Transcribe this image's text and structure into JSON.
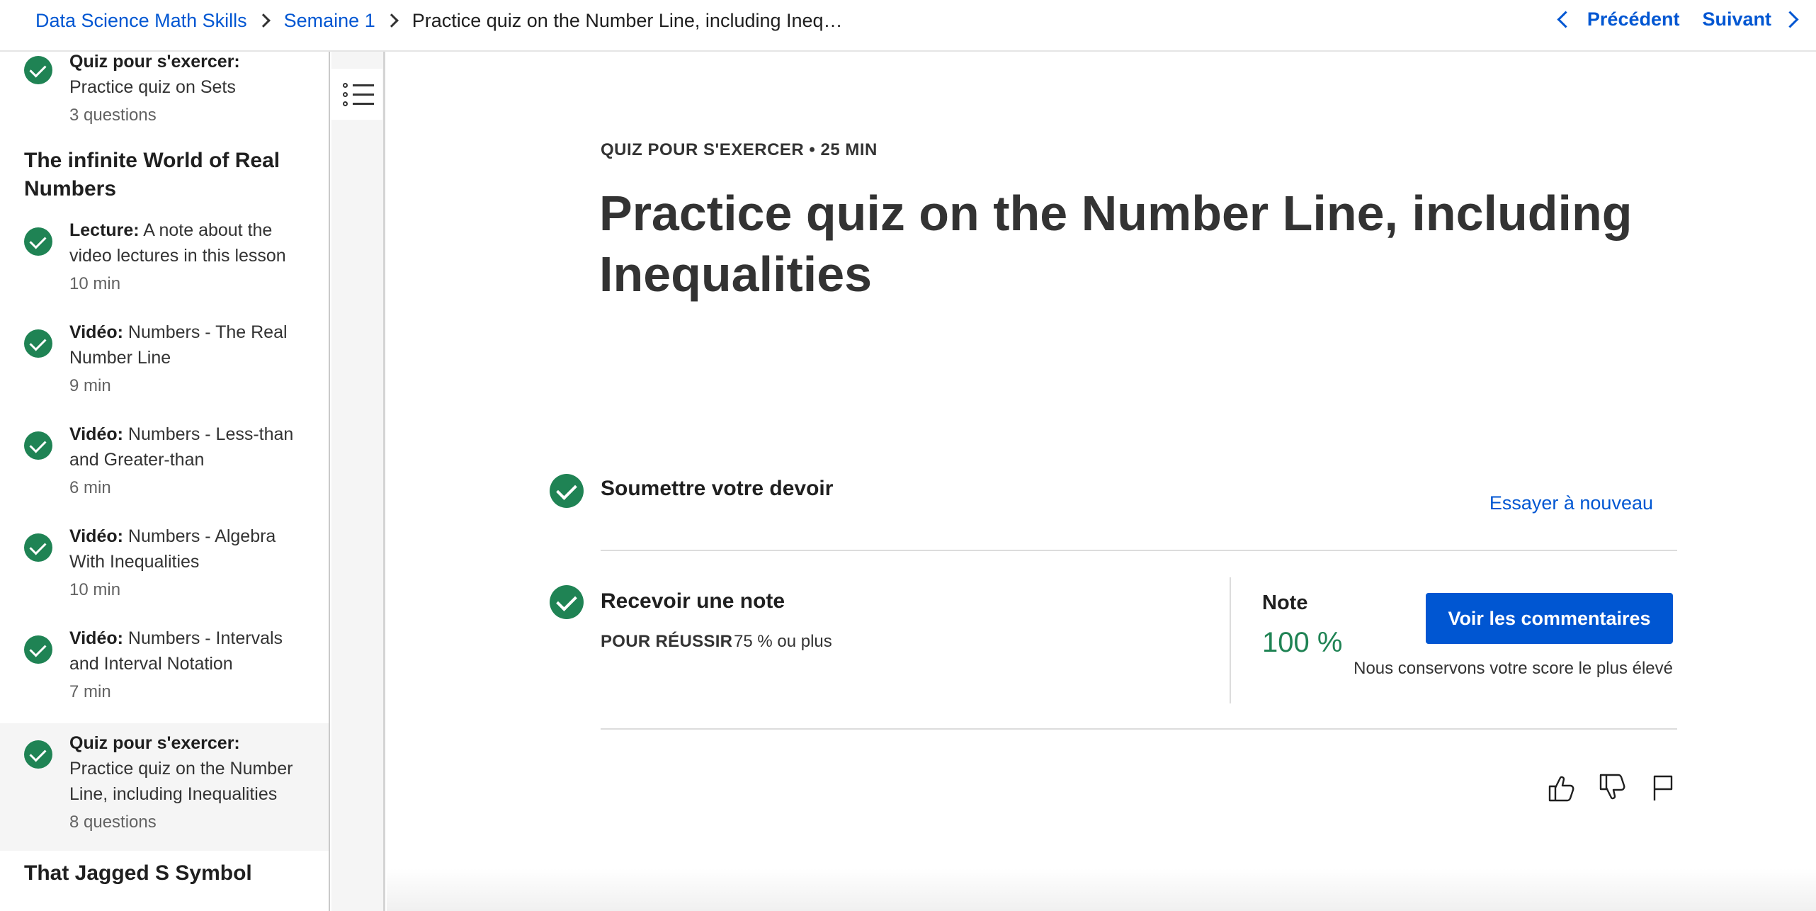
{
  "breadcrumb": {
    "course": "Data Science Math Skills",
    "week": "Semaine 1",
    "current": "Practice quiz on the Number Line, including Ineq…"
  },
  "nav": {
    "prev": "Précédent",
    "next": "Suivant"
  },
  "sidebar": {
    "top_item": {
      "type": "Quiz pour s'exercer:",
      "title": "Practice quiz on Sets",
      "meta": "3 questions"
    },
    "section1_title": "The infinite World of Real Numbers",
    "items": [
      {
        "type": "Lecture:",
        "title": "A note about the video lectures in this lesson",
        "meta": "10 min"
      },
      {
        "type": "Vidéo:",
        "title": "Numbers - The Real Number Line",
        "meta": "9 min"
      },
      {
        "type": "Vidéo:",
        "title": "Numbers - Less-than and Greater-than",
        "meta": "6 min"
      },
      {
        "type": "Vidéo:",
        "title": "Numbers - Algebra With Inequalities",
        "meta": "10 min"
      },
      {
        "type": "Vidéo:",
        "title": "Numbers - Intervals and Interval Notation",
        "meta": "7 min"
      },
      {
        "type": "Quiz pour s'exercer:",
        "title": "Practice quiz on the Number Line, including Inequalities",
        "meta": "8 questions"
      }
    ],
    "section2_title": "That Jagged S Symbol"
  },
  "main": {
    "eyebrow": "QUIZ POUR S'EXERCER • 25 MIN",
    "title": "Practice quiz on the Number Line, including Inequalities",
    "submit_title": "Soumettre votre devoir",
    "retry": "Essayer à nouveau",
    "grade_title": "Recevoir une note",
    "pass_label": "POUR RÉUSSIR",
    "pass_value": "75 % ou plus",
    "note_label": "Note",
    "note_value": "100 %",
    "feedback_button": "Voir les commentaires",
    "keep_note": "Nous conservons votre score le plus élevé"
  },
  "colors": {
    "accent": "#0056d2",
    "success": "#1f8354"
  },
  "icons": [
    "list-outline-icon",
    "check-icon",
    "thumbs-up-icon",
    "thumbs-down-icon",
    "flag-icon"
  ]
}
